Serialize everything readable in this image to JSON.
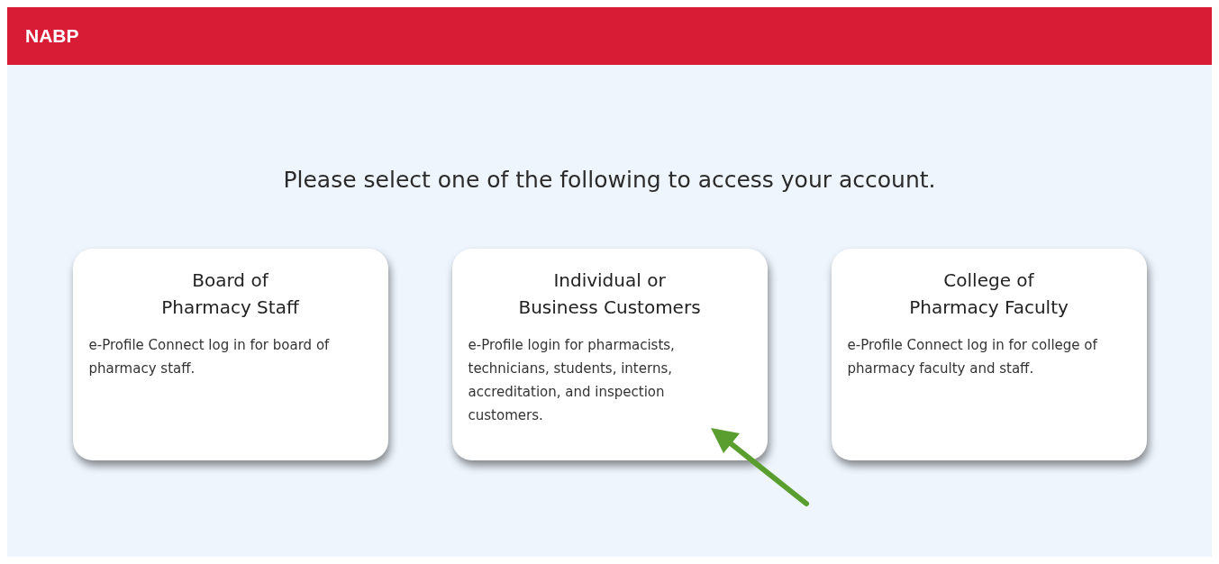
{
  "header": {
    "brand": "NABP"
  },
  "heading": "Please select one of the following to access your account.",
  "cards": [
    {
      "title": "Board of\nPharmacy Staff",
      "description": "e-Profile Connect log in for board of pharmacy staff."
    },
    {
      "title": "Individual or\nBusiness Customers",
      "description": "e-Profile login for pharmacists, technicians, students, interns, accreditation, and inspection customers."
    },
    {
      "title": "College of\nPharmacy Faculty",
      "description": "e-Profile Connect log in for college of pharmacy faculty and staff."
    }
  ],
  "annotation": {
    "kind": "arrow",
    "color": "#5a9e2f"
  }
}
